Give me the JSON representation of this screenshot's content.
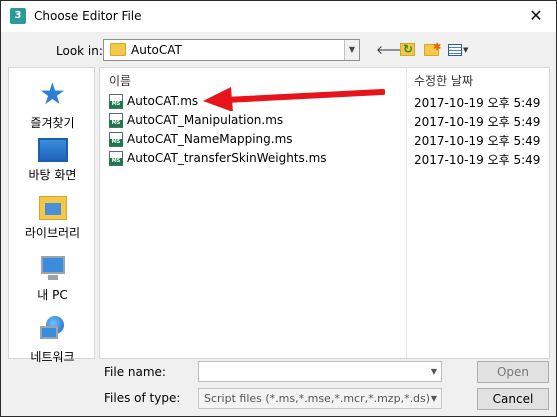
{
  "window": {
    "title": "Choose Editor File",
    "app_icon": "3",
    "close_label": "✕"
  },
  "toolbar": {
    "look_in_label": "Look in:",
    "look_in_value": "AutoCAT",
    "back_label": "🡐"
  },
  "places": [
    {
      "label": "즐겨찾기",
      "icon": "star-icon"
    },
    {
      "label": "바탕 화면",
      "icon": "desktop-icon"
    },
    {
      "label": "라이브러리",
      "icon": "library-icon"
    },
    {
      "label": "내 PC",
      "icon": "pc-icon"
    },
    {
      "label": "네트워크",
      "icon": "network-icon"
    }
  ],
  "filelist": {
    "columns": {
      "name": "이름",
      "date": "수정한 날짜"
    },
    "files": [
      {
        "name": "AutoCAT.ms",
        "date": "2017-10-19 오후 5:49"
      },
      {
        "name": "AutoCAT_Manipulation.ms",
        "date": "2017-10-19 오후 5:49"
      },
      {
        "name": "AutoCAT_NameMapping.ms",
        "date": "2017-10-19 오후 5:49"
      },
      {
        "name": "AutoCAT_transferSkinWeights.ms",
        "date": "2017-10-19 오후 5:49"
      }
    ]
  },
  "bottom": {
    "file_name_label": "File name:",
    "file_name_value": "",
    "file_type_label": "Files of type:",
    "file_type_value": "Script files (*.ms,*.mse,*.mcr,*.mzp,*.ds)",
    "open_label": "Open",
    "cancel_label": "Cancel"
  },
  "colors": {
    "annotation_arrow": "#e8141c",
    "accent": "#2d7fd2"
  }
}
